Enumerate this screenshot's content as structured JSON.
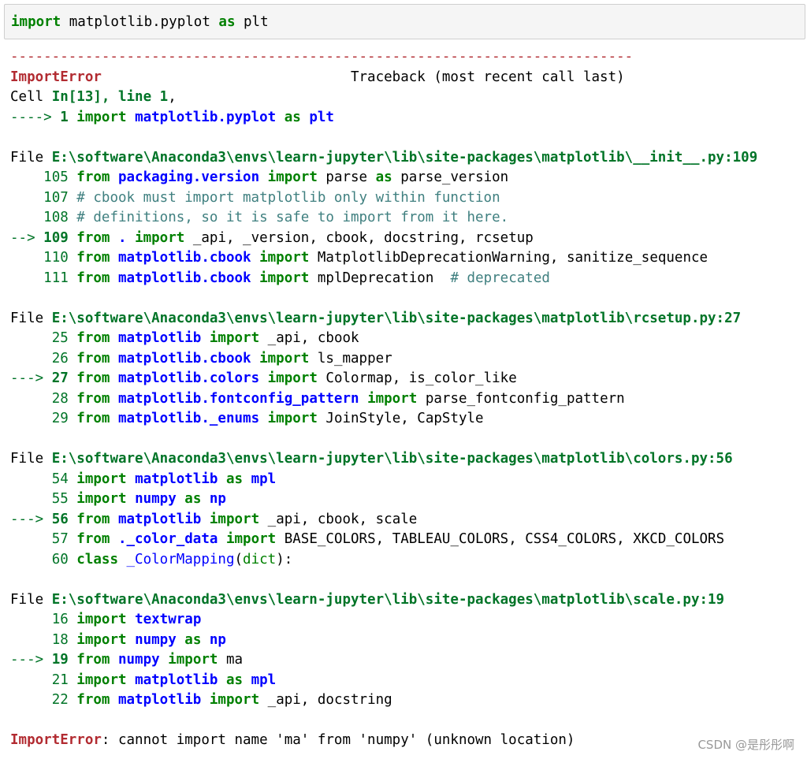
{
  "input_cell": {
    "kw_import": "import",
    "module": " matplotlib.pyplot ",
    "kw_as": "as",
    "alias": " plt"
  },
  "separator": "---------------------------------------------------------------------------",
  "header": {
    "error_name": "ImportError",
    "spacer": "                              ",
    "traceback_label": "Traceback (most recent call last)"
  },
  "cell_ref": {
    "prefix": "Cell ",
    "ref": "In[13], line 1",
    "arrow": "----> ",
    "line_no": "1",
    "code_kw1": " import",
    "code_mod": " matplotlib.pyplot",
    "code_kw2": " as",
    "code_alias": " plt"
  },
  "frames": [
    {
      "file_prefix": "File ",
      "path": "E:\\software\\Anaconda3\\envs\\learn-jupyter\\lib\\site-packages\\matplotlib\\__init__.py:109",
      "lines": [
        {
          "gutter": "    ",
          "num": "105",
          "segs": [
            {
              "c": "kw",
              "t": " from"
            },
            {
              "c": "mod",
              "t": " packaging.version"
            },
            {
              "c": "kw",
              "t": " import"
            },
            {
              "c": "",
              "t": " parse "
            },
            {
              "c": "kw",
              "t": "as"
            },
            {
              "c": "",
              "t": " parse_version"
            }
          ]
        },
        {
          "gutter": "    ",
          "num": "107",
          "segs": [
            {
              "c": "cm",
              "t": " # cbook must import matplotlib only within function"
            }
          ]
        },
        {
          "gutter": "    ",
          "num": "108",
          "segs": [
            {
              "c": "cm",
              "t": " # definitions, so it is safe to import from it here."
            }
          ]
        },
        {
          "gutter": "--> ",
          "num": "109",
          "current": true,
          "segs": [
            {
              "c": "kw",
              "t": " from"
            },
            {
              "c": "mod",
              "t": " ."
            },
            {
              "c": "kw",
              "t": " import"
            },
            {
              "c": "",
              "t": " _api, _version, cbook, docstring, rcsetup"
            }
          ]
        },
        {
          "gutter": "    ",
          "num": "110",
          "segs": [
            {
              "c": "kw",
              "t": " from"
            },
            {
              "c": "mod",
              "t": " matplotlib.cbook"
            },
            {
              "c": "kw",
              "t": " import"
            },
            {
              "c": "",
              "t": " MatplotlibDeprecationWarning, sanitize_sequence"
            }
          ]
        },
        {
          "gutter": "    ",
          "num": "111",
          "segs": [
            {
              "c": "kw",
              "t": " from"
            },
            {
              "c": "mod",
              "t": " matplotlib.cbook"
            },
            {
              "c": "kw",
              "t": " import"
            },
            {
              "c": "",
              "t": " mplDeprecation  "
            },
            {
              "c": "cm",
              "t": "# deprecated"
            }
          ]
        }
      ]
    },
    {
      "file_prefix": "File ",
      "path": "E:\\software\\Anaconda3\\envs\\learn-jupyter\\lib\\site-packages\\matplotlib\\rcsetup.py:27",
      "lines": [
        {
          "gutter": "     ",
          "num": "25",
          "segs": [
            {
              "c": "kw",
              "t": " from"
            },
            {
              "c": "mod",
              "t": " matplotlib"
            },
            {
              "c": "kw",
              "t": " import"
            },
            {
              "c": "",
              "t": " _api, cbook"
            }
          ]
        },
        {
          "gutter": "     ",
          "num": "26",
          "segs": [
            {
              "c": "kw",
              "t": " from"
            },
            {
              "c": "mod",
              "t": " matplotlib.cbook"
            },
            {
              "c": "kw",
              "t": " import"
            },
            {
              "c": "",
              "t": " ls_mapper"
            }
          ]
        },
        {
          "gutter": "---> ",
          "num": "27",
          "current": true,
          "segs": [
            {
              "c": "kw",
              "t": " from"
            },
            {
              "c": "mod",
              "t": " matplotlib.colors"
            },
            {
              "c": "kw",
              "t": " import"
            },
            {
              "c": "",
              "t": " Colormap, is_color_like"
            }
          ]
        },
        {
          "gutter": "     ",
          "num": "28",
          "segs": [
            {
              "c": "kw",
              "t": " from"
            },
            {
              "c": "mod",
              "t": " matplotlib.fontconfig_pattern"
            },
            {
              "c": "kw",
              "t": " import"
            },
            {
              "c": "",
              "t": " parse_fontconfig_pattern"
            }
          ]
        },
        {
          "gutter": "     ",
          "num": "29",
          "segs": [
            {
              "c": "kw",
              "t": " from"
            },
            {
              "c": "mod",
              "t": " matplotlib._enums"
            },
            {
              "c": "kw",
              "t": " import"
            },
            {
              "c": "",
              "t": " JoinStyle, CapStyle"
            }
          ]
        }
      ]
    },
    {
      "file_prefix": "File ",
      "path": "E:\\software\\Anaconda3\\envs\\learn-jupyter\\lib\\site-packages\\matplotlib\\colors.py:56",
      "lines": [
        {
          "gutter": "     ",
          "num": "54",
          "segs": [
            {
              "c": "kw",
              "t": " import"
            },
            {
              "c": "mod",
              "t": " matplotlib"
            },
            {
              "c": "kw",
              "t": " as"
            },
            {
              "c": "mod",
              "t": " mpl"
            }
          ]
        },
        {
          "gutter": "     ",
          "num": "55",
          "segs": [
            {
              "c": "kw",
              "t": " import"
            },
            {
              "c": "mod",
              "t": " numpy"
            },
            {
              "c": "kw",
              "t": " as"
            },
            {
              "c": "mod",
              "t": " np"
            }
          ]
        },
        {
          "gutter": "---> ",
          "num": "56",
          "current": true,
          "segs": [
            {
              "c": "kw",
              "t": " from"
            },
            {
              "c": "mod",
              "t": " matplotlib"
            },
            {
              "c": "kw",
              "t": " import"
            },
            {
              "c": "",
              "t": " _api, cbook, scale"
            }
          ]
        },
        {
          "gutter": "     ",
          "num": "57",
          "segs": [
            {
              "c": "kw",
              "t": " from"
            },
            {
              "c": "mod",
              "t": " ._color_data"
            },
            {
              "c": "kw",
              "t": " import"
            },
            {
              "c": "",
              "t": " BASE_COLORS, TABLEAU_COLORS, CSS4_COLORS, XKCD_COLORS"
            }
          ]
        },
        {
          "gutter": "     ",
          "num": "60",
          "segs": [
            {
              "c": "kw",
              "t": " class"
            },
            {
              "c": "fn",
              "t": " _ColorMapping"
            },
            {
              "c": "",
              "t": "("
            },
            {
              "c": "kw2",
              "t": "dict"
            },
            {
              "c": "",
              "t": "):"
            }
          ]
        }
      ]
    },
    {
      "file_prefix": "File ",
      "path": "E:\\software\\Anaconda3\\envs\\learn-jupyter\\lib\\site-packages\\matplotlib\\scale.py:19",
      "lines": [
        {
          "gutter": "     ",
          "num": "16",
          "segs": [
            {
              "c": "kw",
              "t": " import"
            },
            {
              "c": "mod",
              "t": " textwrap"
            }
          ]
        },
        {
          "gutter": "     ",
          "num": "18",
          "segs": [
            {
              "c": "kw",
              "t": " import"
            },
            {
              "c": "mod",
              "t": " numpy"
            },
            {
              "c": "kw",
              "t": " as"
            },
            {
              "c": "mod",
              "t": " np"
            }
          ]
        },
        {
          "gutter": "---> ",
          "num": "19",
          "current": true,
          "segs": [
            {
              "c": "kw",
              "t": " from"
            },
            {
              "c": "mod",
              "t": " numpy"
            },
            {
              "c": "kw",
              "t": " import"
            },
            {
              "c": "",
              "t": " ma"
            }
          ]
        },
        {
          "gutter": "     ",
          "num": "21",
          "segs": [
            {
              "c": "kw",
              "t": " import"
            },
            {
              "c": "mod",
              "t": " matplotlib"
            },
            {
              "c": "kw",
              "t": " as"
            },
            {
              "c": "mod",
              "t": " mpl"
            }
          ]
        },
        {
          "gutter": "     ",
          "num": "22",
          "segs": [
            {
              "c": "kw",
              "t": " from"
            },
            {
              "c": "mod",
              "t": " matplotlib"
            },
            {
              "c": "kw",
              "t": " import"
            },
            {
              "c": "",
              "t": " _api, docstring"
            }
          ]
        }
      ]
    }
  ],
  "final_error": {
    "name": "ImportError",
    "message": ": cannot import name 'ma' from 'numpy' (unknown location)"
  },
  "watermark": "CSDN @是彤彤啊"
}
